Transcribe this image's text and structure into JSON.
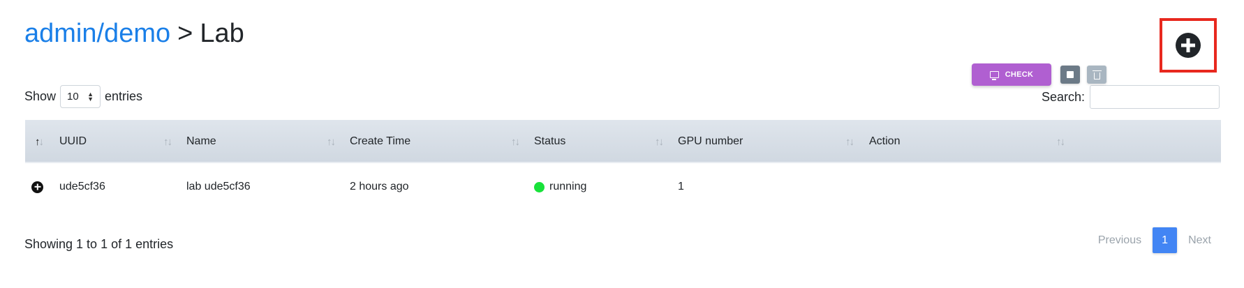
{
  "breadcrumb": {
    "link": "admin/demo",
    "separator": ">",
    "current": "Lab"
  },
  "add_button": {
    "icon": "plus-circle-icon",
    "highlight_color": "#e8281e"
  },
  "length_menu": {
    "prefix": "Show",
    "selected": "10",
    "suffix": "entries"
  },
  "search": {
    "label": "Search:",
    "value": ""
  },
  "table": {
    "columns": [
      "UUID",
      "Name",
      "Create Time",
      "Status",
      "GPU number",
      "Action"
    ],
    "sort_icon": "↑↓",
    "rows": [
      {
        "uuid": "ude5cf36",
        "name": "lab ude5cf36",
        "create_time": "2 hours ago",
        "status": "running",
        "status_color": "#18e23a",
        "gpu": "1",
        "actions": {
          "check_label": "CHECK"
        }
      }
    ]
  },
  "info": "Showing 1 to 1 of 1 entries",
  "pagination": {
    "previous": "Previous",
    "current_page": "1",
    "next": "Next"
  },
  "colors": {
    "link": "#1a7fe8",
    "check_button": "#b05fd1",
    "page_active": "#4285f4"
  }
}
